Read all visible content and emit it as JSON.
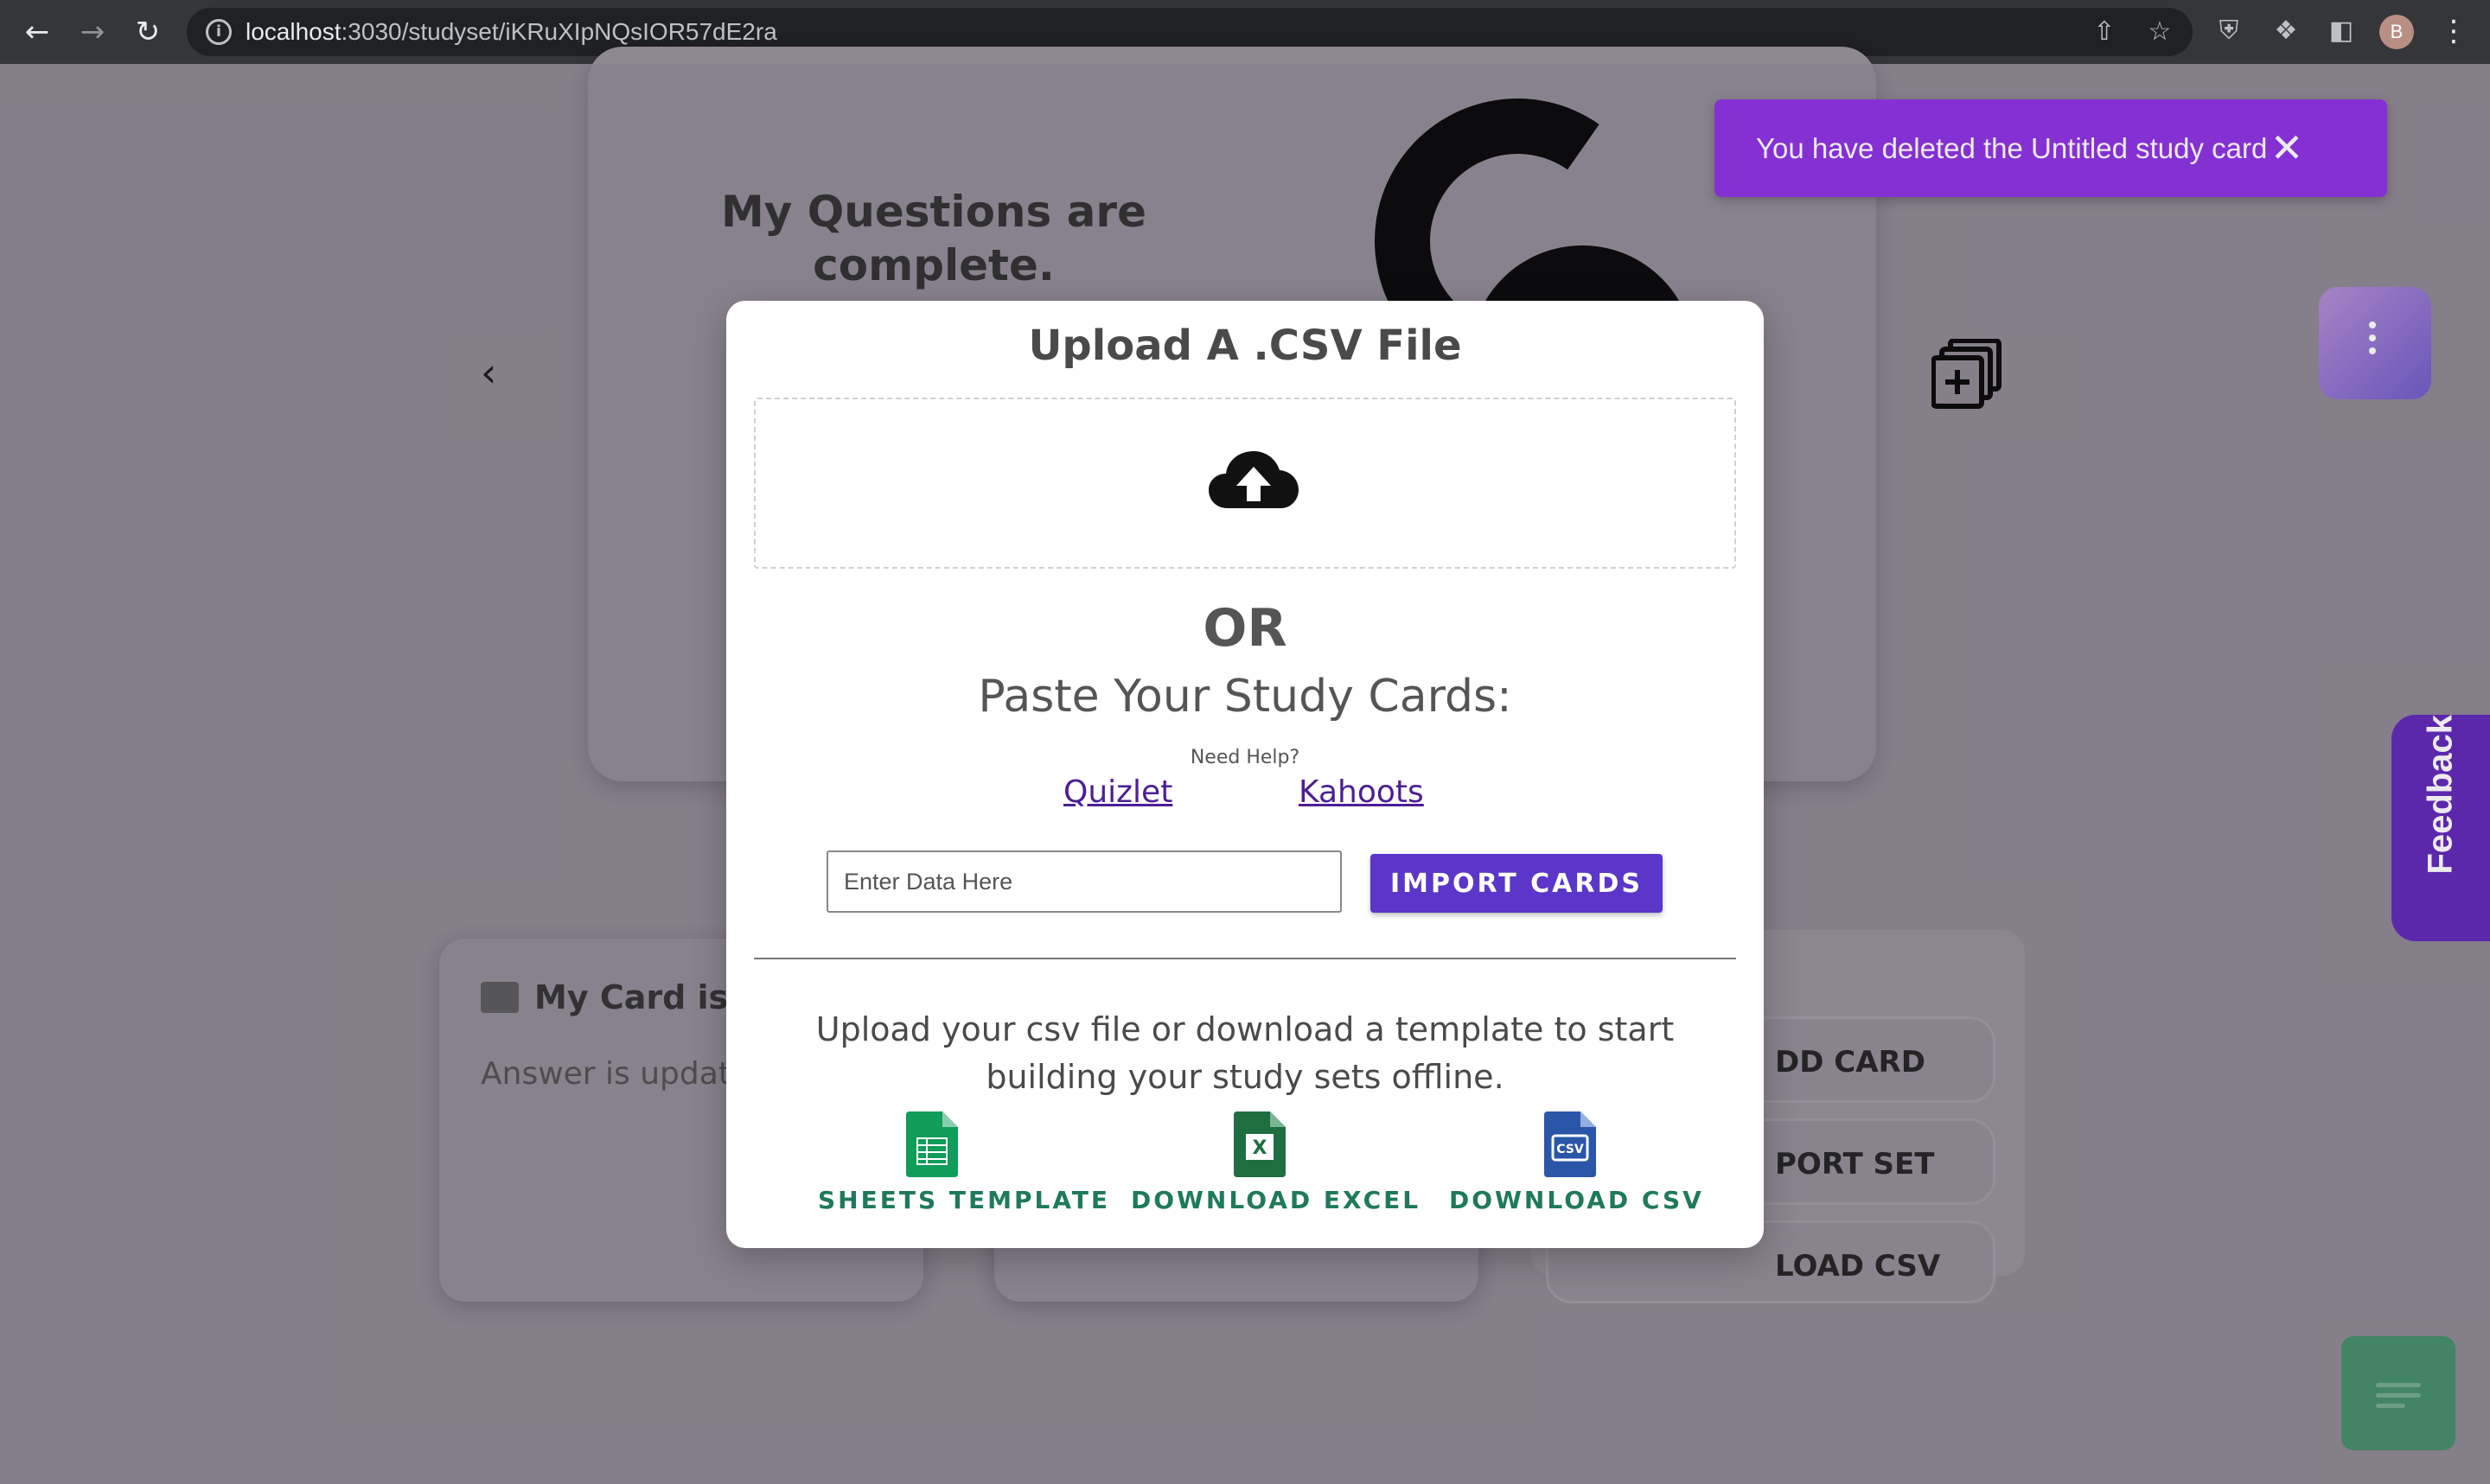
{
  "browser": {
    "url_host": "localhost",
    "url_path": ":3030/studyset/iKRuXIpNQsIOR57dE2ra",
    "profile_initial": "B"
  },
  "background": {
    "question_text": "My Questions are complete.",
    "card_title": "My Card is to",
    "card_answer": "Answer is updat",
    "actions": [
      "DD CARD",
      "PORT SET",
      "LOAD CSV"
    ]
  },
  "toast": {
    "message": "You have deleted the Untitled study card"
  },
  "feedback": {
    "label": "Feedback"
  },
  "modal": {
    "title": "Upload A .CSV File",
    "or_text": "OR",
    "paste_heading": "Paste Your Study Cards:",
    "help_text": "Need Help?",
    "links": {
      "quizlet": "Quizlet",
      "kahoots": "Kahoots"
    },
    "input_placeholder": "Enter Data Here",
    "import_button": "IMPORT CARDS",
    "description": "Upload your csv file or download a template to start building your study sets offline.",
    "downloads": {
      "sheets": "SHEETS TEMPLATE",
      "excel": "DOWNLOAD EXCEL",
      "csv": "DOWNLOAD CSV"
    }
  },
  "colors": {
    "toast_bg": "#8a2be2",
    "import_btn": "#5b36c8",
    "feedback_tab": "#5a22b5",
    "download_label": "#1f7a5a"
  }
}
